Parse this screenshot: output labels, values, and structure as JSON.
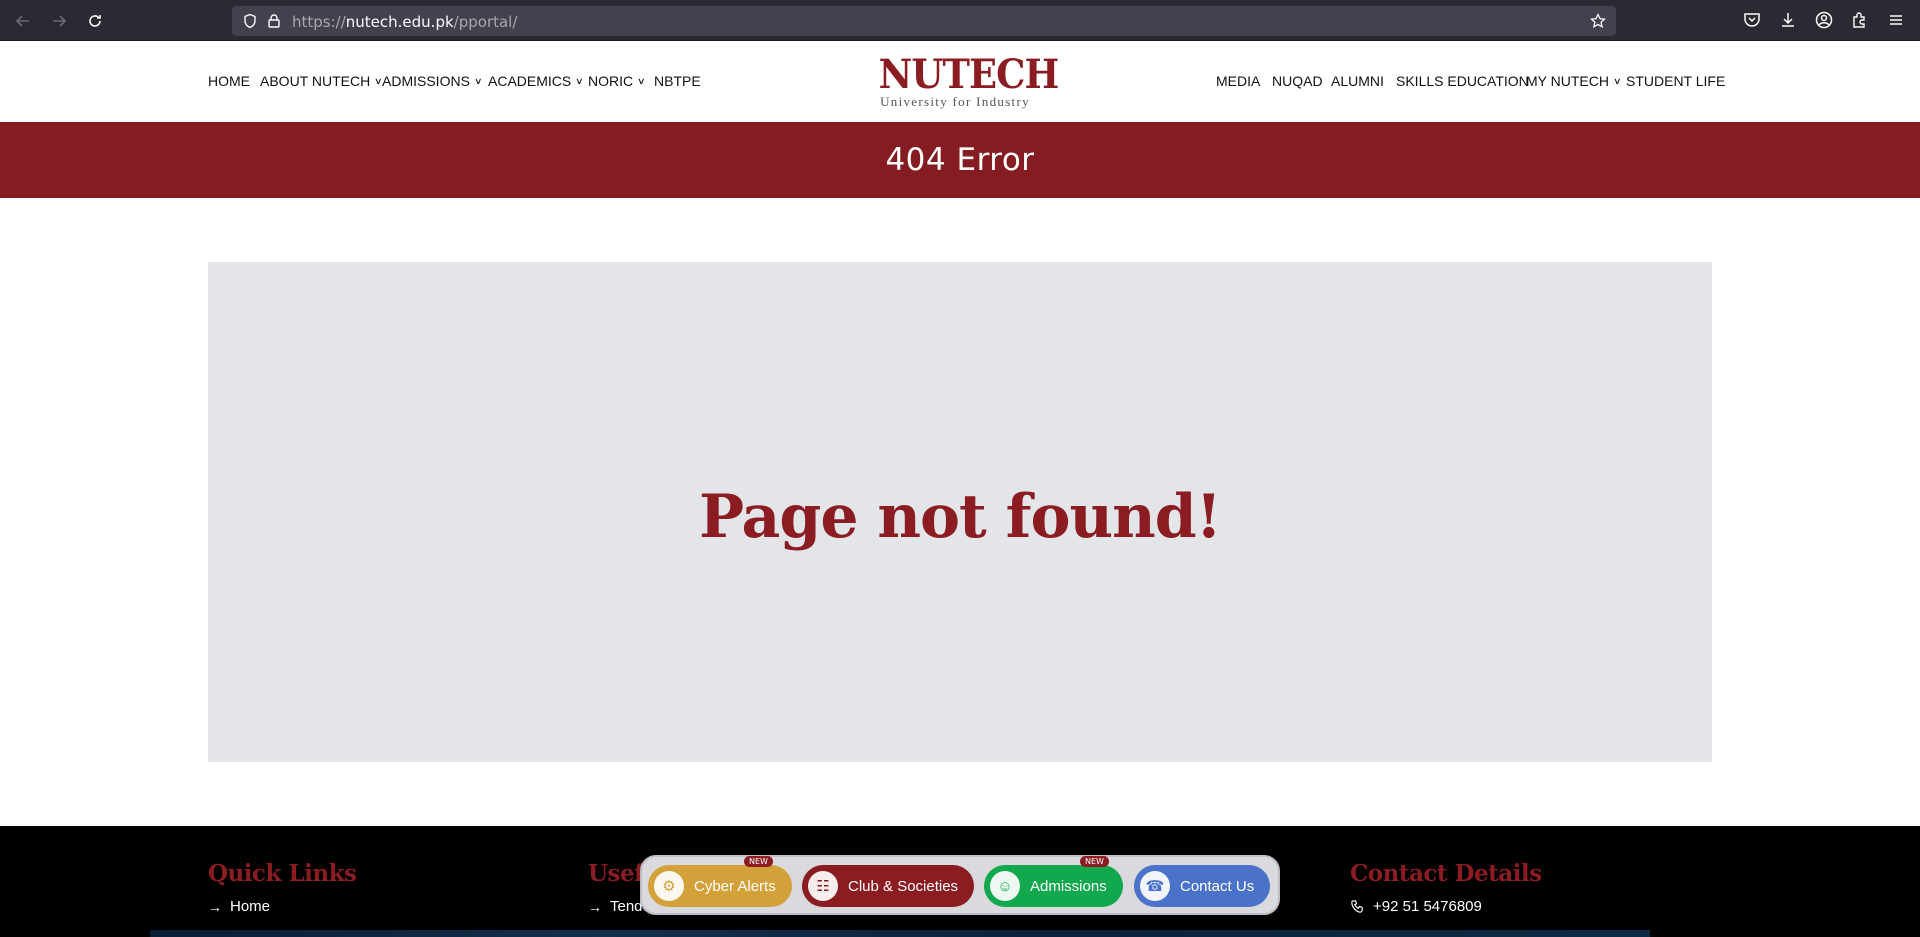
{
  "browser": {
    "url_prefix": "https://",
    "url_domain": "nutech.edu.pk",
    "url_path": "/pportal/"
  },
  "header": {
    "nav_left": [
      {
        "label": "HOME",
        "has_dropdown": false
      },
      {
        "label": "ABOUT NUTECH",
        "has_dropdown": true
      },
      {
        "label": "ADMISSIONS",
        "has_dropdown": true
      },
      {
        "label": "ACADEMICS",
        "has_dropdown": true
      },
      {
        "label": "NORIC",
        "has_dropdown": true
      },
      {
        "label": "NBTPE",
        "has_dropdown": false
      }
    ],
    "nav_right": [
      {
        "label": "MEDIA",
        "has_dropdown": false
      },
      {
        "label": "NUQAD",
        "has_dropdown": false
      },
      {
        "label": "ALUMNI",
        "has_dropdown": false
      },
      {
        "label": "SKILLS EDUCATION",
        "has_dropdown": false
      },
      {
        "label": "MY NUTECH",
        "has_dropdown": true
      },
      {
        "label": "STUDENT LIFE",
        "has_dropdown": false
      }
    ],
    "logo_main": "NUTECH",
    "logo_sub": "University for Industry"
  },
  "banner": {
    "title": "404 Error"
  },
  "main": {
    "message": "Page not found!"
  },
  "footer": {
    "quick_links_heading": "Quick Links",
    "quick_links_first": "Home",
    "useful_heading": "Useful",
    "useful_first": "Tende",
    "contact_heading": "Contact Details",
    "contact_phone": "+92 51 5476809"
  },
  "dock": {
    "items": [
      {
        "label": "Cyber Alerts",
        "badge": "NEW",
        "color": "#d4a03a",
        "icon": "alert-icon"
      },
      {
        "label": "Club & Societies",
        "badge": "",
        "color": "#8a1c22",
        "icon": "newspaper-icon"
      },
      {
        "label": "Admissions",
        "badge": "NEW",
        "color": "#12a84d",
        "icon": "graduate-icon"
      },
      {
        "label": "Contact Us",
        "badge": "",
        "color": "#4a72c8",
        "icon": "phone-icon"
      }
    ]
  },
  "colors": {
    "brand": "#841c21",
    "content_bg": "#e4e5e9"
  }
}
